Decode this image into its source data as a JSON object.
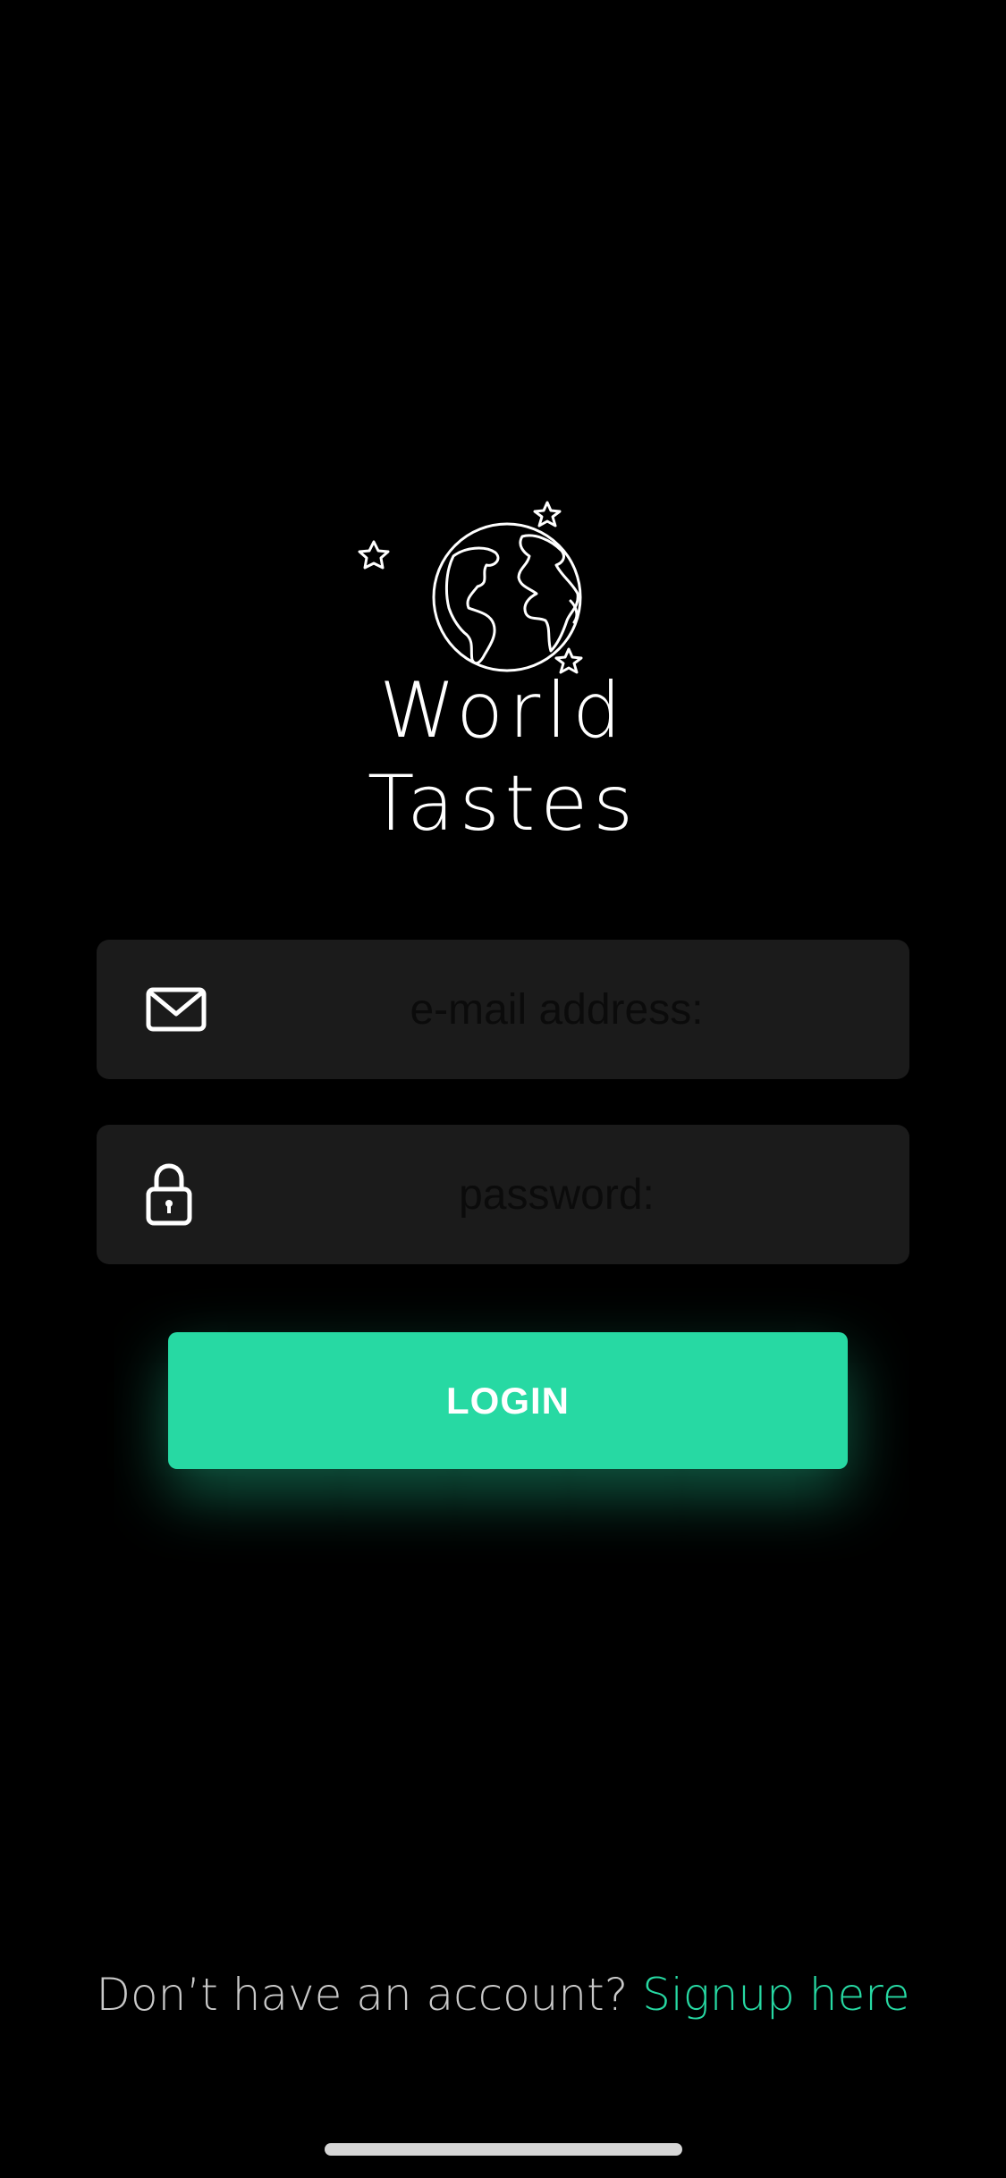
{
  "app": {
    "logo_line_1": "World",
    "logo_line_2": "Tastes",
    "logo_icon": "globe-with-stars-icon"
  },
  "form": {
    "email_placeholder": "e-mail address:",
    "email_icon": "envelope-icon",
    "password_placeholder": "password:",
    "password_icon": "padlock-icon",
    "login_label": "LOGIN"
  },
  "footer": {
    "prompt": "Don’t have an account?",
    "signup_label": "Signup here"
  },
  "colors": {
    "accent": "#27d9a3",
    "background": "#000000",
    "field_background": "#1b1b1b"
  }
}
